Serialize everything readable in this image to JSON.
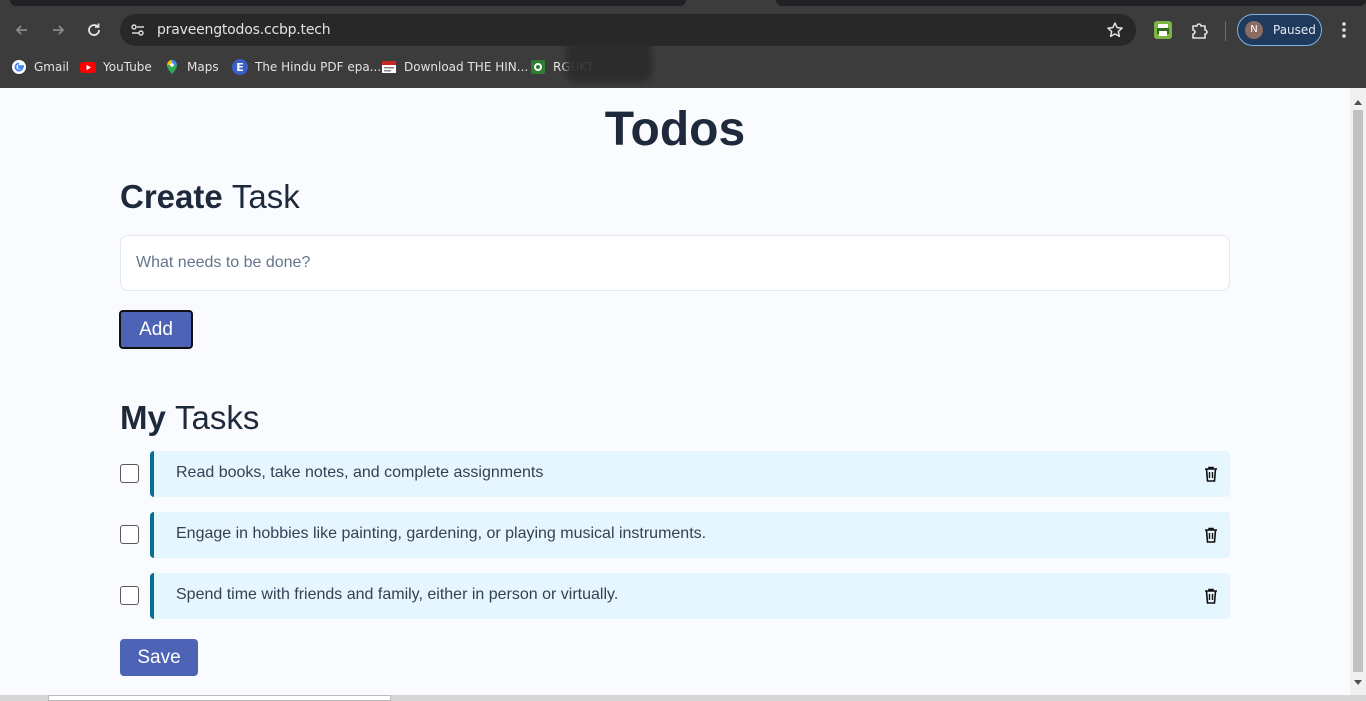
{
  "browser": {
    "url": "praveengtodos.ccbp.tech",
    "profile_initial": "N",
    "profile_status": "Paused",
    "bookmarks": [
      {
        "label": "Gmail",
        "icon": "google-icon"
      },
      {
        "label": "YouTube",
        "icon": "youtube-icon"
      },
      {
        "label": "Maps",
        "icon": "maps-icon"
      },
      {
        "label": "The Hindu PDF epa...",
        "icon": "e-icon"
      },
      {
        "label": "Download THE HIN...",
        "icon": "doc-icon"
      },
      {
        "label": "RGUKT",
        "icon": "rgukt-icon"
      }
    ]
  },
  "page": {
    "title": "Todos",
    "create": {
      "bold": "Create",
      "light": "Task"
    },
    "input_placeholder": "What needs to be done?",
    "add_label": "Add",
    "tasks_heading": {
      "bold": "My",
      "light": "Tasks"
    },
    "tasks": [
      {
        "label": "Read books, take notes, and complete assignments",
        "checked": false
      },
      {
        "label": "Engage in hobbies like painting, gardening, or playing musical instruments.",
        "checked": false
      },
      {
        "label": "Spend time with friends and family, either in person or virtually.",
        "checked": false
      }
    ],
    "save_label": "Save"
  },
  "colors": {
    "accent": "#4c63b6",
    "task_bg": "#e6f6ff",
    "task_border": "#096f92"
  }
}
